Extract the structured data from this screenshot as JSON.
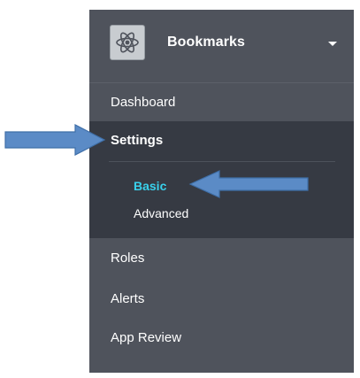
{
  "app": {
    "name": "Bookmarks",
    "icon": "atom-icon",
    "dropdown_icon": "caret-down-icon"
  },
  "nav": {
    "dashboard": "Dashboard",
    "settings": "Settings",
    "settings_children": {
      "basic": "Basic",
      "advanced": "Advanced"
    },
    "roles": "Roles",
    "alerts": "Alerts",
    "app_review": "App Review"
  },
  "colors": {
    "sidebar": "#4f535c",
    "active_section": "#363a43",
    "active_link": "#39d1ec",
    "callout_arrow": "#5b8bc6"
  }
}
